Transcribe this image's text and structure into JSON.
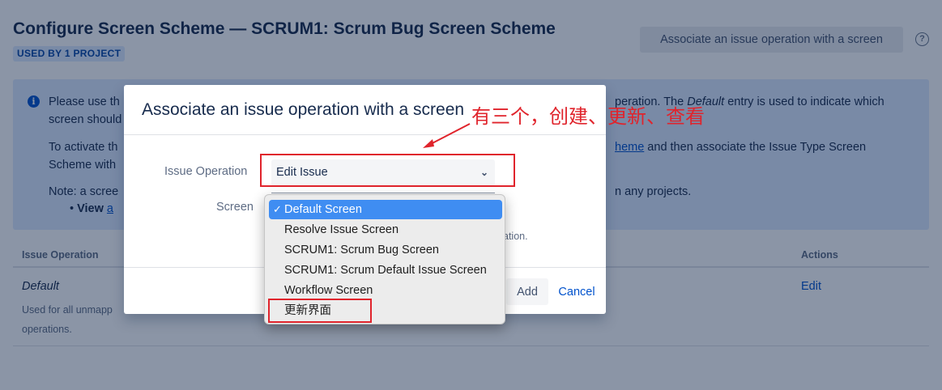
{
  "page": {
    "title": "Configure Screen Scheme — SCRUM1: Scrum Bug Screen Scheme",
    "used_by": "USED BY 1 PROJECT",
    "associate_button": "Associate an issue operation with a screen",
    "help_icon": "question-circle-icon",
    "info": {
      "line1_visible": "Please use th",
      "line1_right_pre": "peration. The ",
      "line1_right_em": "Default",
      "line1_right_post": " entry is used to indicate which",
      "line2_visible": "screen should",
      "line3_visible": "To activate th",
      "line3_link": "heme",
      "line3_right": " and then associate the Issue Type Screen",
      "line4_visible": "Scheme with",
      "line5_visible": "Note: a scree",
      "line5_right": "n any projects.",
      "line6_visible": "View ",
      "line6_link": "a"
    },
    "table": {
      "col_operation": "Issue Operation",
      "col_actions": "Actions",
      "row_name": "Default",
      "row_desc1": "Used for all unmapp",
      "row_desc2": "operations.",
      "row_action": "Edit"
    }
  },
  "dialog": {
    "title": "Associate an issue operation with a screen",
    "issue_operation_label": "Issue Operation",
    "issue_operation_value": "Edit Issue",
    "screen_label": "Screen",
    "hint_fragment": "ation.",
    "add_button": "Add",
    "cancel_button": "Cancel"
  },
  "dropdown": {
    "selected_index": 0,
    "options": [
      "Default Screen",
      "Resolve Issue Screen",
      "SCRUM1: Scrum Bug Screen",
      "SCRUM1: Scrum Default Issue Screen",
      "Workflow Screen",
      "更新界面"
    ]
  },
  "annotation": {
    "text": "有三个，创建、更新、查看",
    "color": "#e0242c"
  },
  "colors": {
    "accent": "#0052cc",
    "selection": "#3f8df2",
    "annotation_red": "#e0242c"
  }
}
